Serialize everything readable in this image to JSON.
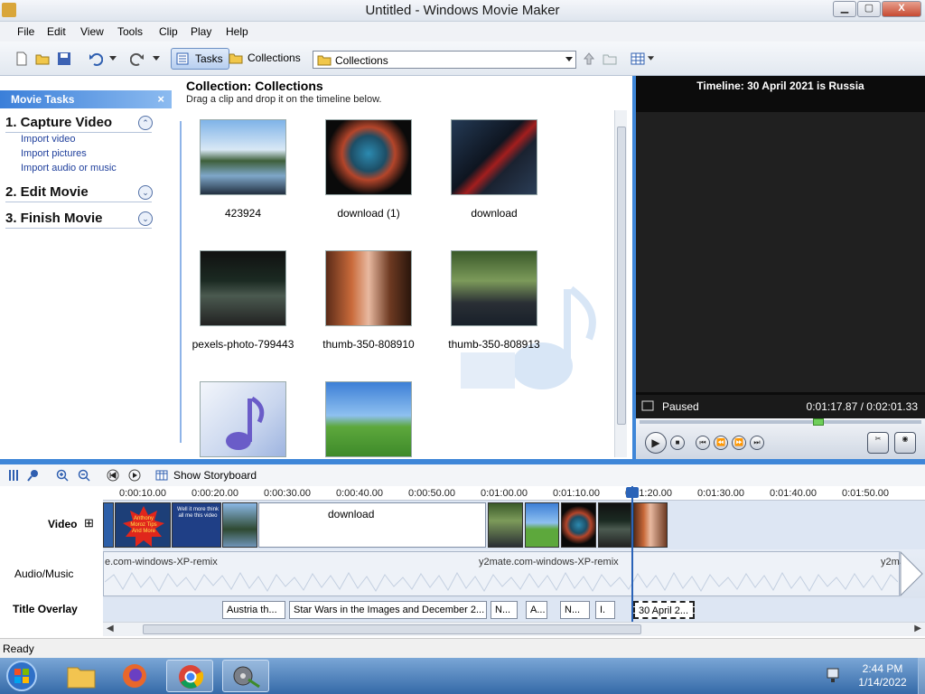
{
  "window": {
    "title": "Untitled - Windows Movie Maker",
    "minimize": "▁",
    "maximize": "▢",
    "close": "X"
  },
  "menu": [
    "File",
    "Edit",
    "View",
    "Tools",
    "Clip",
    "Play",
    "Help"
  ],
  "toolbar": {
    "tasks_label": "Tasks",
    "collections_label": "Collections",
    "collection_select": "Collections"
  },
  "tasks": {
    "header": "Movie Tasks",
    "close": "×",
    "sections": [
      {
        "title": "1. Capture Video",
        "toggle": "⌃",
        "links": [
          "Import video",
          "Import pictures",
          "Import audio or music"
        ]
      },
      {
        "title": "2. Edit Movie",
        "toggle": "⌄"
      },
      {
        "title": "3. Finish Movie",
        "toggle": "⌄"
      }
    ]
  },
  "collection": {
    "title": "Collection: Collections",
    "subtitle": "Drag a clip and drop it on the timeline below.",
    "items": [
      {
        "label": "423924"
      },
      {
        "label": "download (1)"
      },
      {
        "label": "download"
      },
      {
        "label": "pexels-photo-799443"
      },
      {
        "label": "thumb-350-808910"
      },
      {
        "label": "thumb-350-808913"
      },
      {
        "label": ""
      },
      {
        "label": ""
      }
    ]
  },
  "preview": {
    "title": "Timeline: 30 April 2021 is Russia",
    "status": "Paused",
    "time": "0:01:17.87 / 0:02:01.33"
  },
  "timeline": {
    "show_storyboard": "Show Storyboard",
    "ruler": [
      "0:00:10.00",
      "0:00:20.00",
      "0:00:30.00",
      "0:00:40.00",
      "0:00:50.00",
      "0:01:00.00",
      "0:01:10.00",
      "0:01:20.00",
      "0:01:30.00",
      "0:01:40.00",
      "0:01:50.00"
    ],
    "tracks": {
      "video": "Video",
      "video_expand": "⊞",
      "audio": "Audio/Music",
      "overlay": "Title Overlay"
    },
    "video_clip_label": "download",
    "audio_labels": [
      "e.com-windows-XP-remix",
      "y2mate.com-windows-XP-remix",
      "y2ma"
    ],
    "overlay_clips": [
      "Austria th...",
      "Star Wars in the Images and December 2...",
      "N...",
      "A...",
      "N...",
      "I.",
      "30 April 2..."
    ],
    "clip_text_1": "Anthony Moroz Tips And More",
    "clip_text_2": "Well it more think all me this video"
  },
  "status": {
    "text": "Ready"
  },
  "taskbar": {
    "time": "2:44 PM",
    "date": "1/14/2022"
  }
}
